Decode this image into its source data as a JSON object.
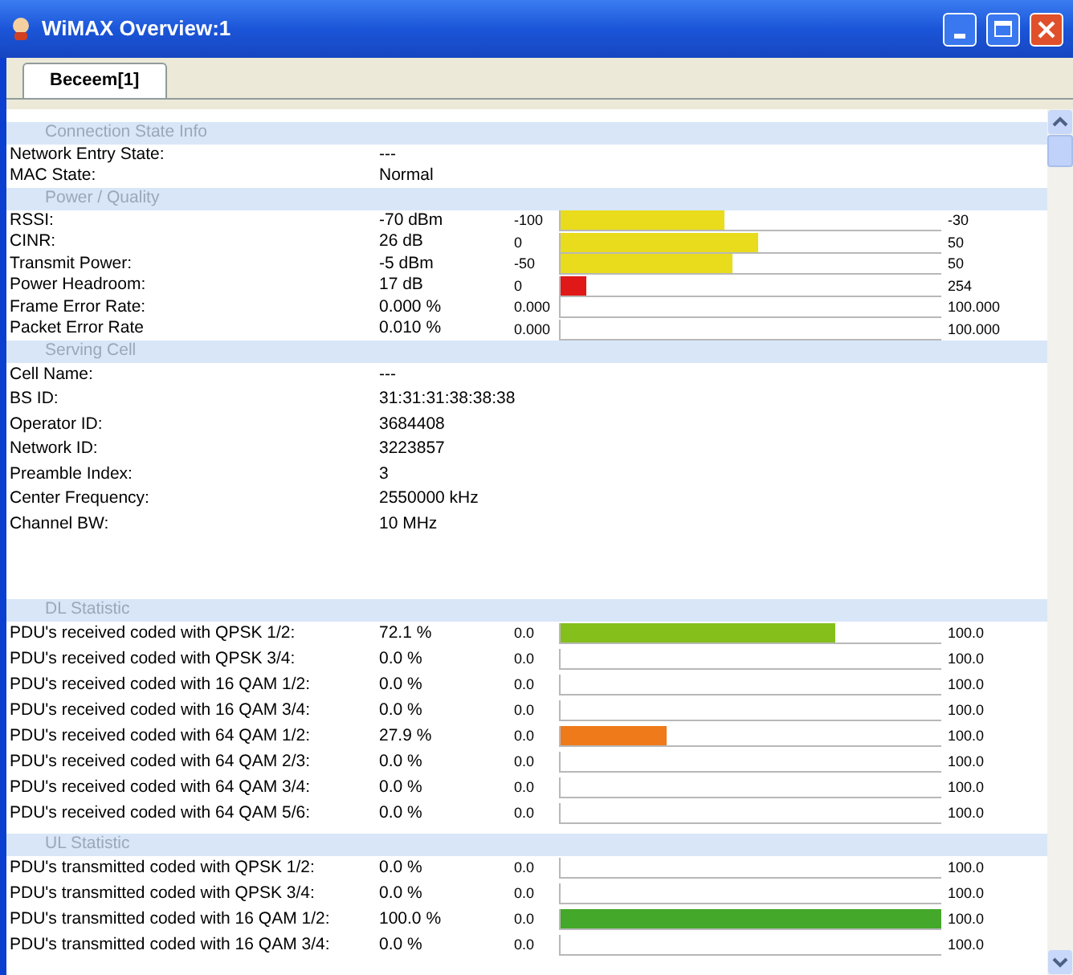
{
  "window": {
    "title": "WiMAX Overview:1"
  },
  "tabs": [
    {
      "label": "Beceem[1]",
      "selected": true
    }
  ],
  "sections": [
    {
      "title": "Connection State Info",
      "rows": [
        {
          "kind": "text",
          "label": "Network Entry State:",
          "value": "---"
        },
        {
          "kind": "text",
          "label": "MAC State:",
          "value": "Normal"
        }
      ]
    },
    {
      "title": "Power / Quality",
      "rows": [
        {
          "kind": "bar",
          "label": "RSSI:",
          "value": "-70 dBm",
          "min": "-100",
          "max": "-30",
          "level": 0.43,
          "color": "#e8dc1c"
        },
        {
          "kind": "bar",
          "label": "CINR:",
          "value": "26 dB",
          "min": "0",
          "max": "50",
          "level": 0.52,
          "color": "#e8dc1c"
        },
        {
          "kind": "bar",
          "label": "Transmit Power:",
          "value": "-5 dBm",
          "min": "-50",
          "max": "50",
          "level": 0.45,
          "color": "#e8dc1c"
        },
        {
          "kind": "bar",
          "label": "Power Headroom:",
          "value": "17 dB",
          "min": "0",
          "max": "254",
          "level": 0.067,
          "color": "#e01818"
        },
        {
          "kind": "bar",
          "label": "Frame Error Rate:",
          "value": "0.000 %",
          "min": "0.000",
          "max": "100.000"
        },
        {
          "kind": "bar",
          "label": "Packet Error Rate",
          "value": "0.010 %",
          "min": "0.000",
          "max": "100.000"
        }
      ]
    },
    {
      "title": "Serving Cell",
      "rows": [
        {
          "kind": "text",
          "label": "Cell Name:",
          "value": "---"
        },
        {
          "kind": "text",
          "label": "BS ID:",
          "value": "31:31:31:38:38:38"
        },
        {
          "kind": "text",
          "label": "Operator ID:",
          "value": "3684408"
        },
        {
          "kind": "text",
          "label": "Network ID:",
          "value": "3223857"
        },
        {
          "kind": "text",
          "label": "Preamble Index:",
          "value": "3"
        },
        {
          "kind": "text",
          "label": "Center Frequency:",
          "value": "2550000 kHz"
        },
        {
          "kind": "text",
          "label": "Channel BW:",
          "value": "10 MHz"
        }
      ]
    },
    {
      "title": "DL Statistic",
      "rows": [
        {
          "kind": "bar",
          "label": "PDU's received coded with QPSK 1/2:",
          "value": "72.1 %",
          "min": "0.0",
          "max": "100.0",
          "level": 0.721,
          "color": "#84bf1c"
        },
        {
          "kind": "bar",
          "label": "PDU's received coded with QPSK 3/4:",
          "value": "0.0 %",
          "min": "0.0",
          "max": "100.0"
        },
        {
          "kind": "bar",
          "label": "PDU's received coded with 16 QAM 1/2:",
          "value": "0.0 %",
          "min": "0.0",
          "max": "100.0"
        },
        {
          "kind": "bar",
          "label": "PDU's received coded with 16 QAM 3/4:",
          "value": "0.0 %",
          "min": "0.0",
          "max": "100.0"
        },
        {
          "kind": "bar",
          "label": "PDU's received coded with 64 QAM 1/2:",
          "value": "27.9 %",
          "min": "0.0",
          "max": "100.0",
          "level": 0.279,
          "color": "#ee7a1a"
        },
        {
          "kind": "bar",
          "label": "PDU's received coded with 64 QAM 2/3:",
          "value": "0.0 %",
          "min": "0.0",
          "max": "100.0"
        },
        {
          "kind": "bar",
          "label": "PDU's received coded with 64 QAM 3/4:",
          "value": "0.0 %",
          "min": "0.0",
          "max": "100.0"
        },
        {
          "kind": "bar",
          "label": "PDU's received coded with 64 QAM 5/6:",
          "value": "0.0 %",
          "min": "0.0",
          "max": "100.0"
        }
      ]
    },
    {
      "title": "UL Statistic",
      "rows": [
        {
          "kind": "bar",
          "label": "PDU's transmitted coded with QPSK 1/2:",
          "value": "0.0 %",
          "min": "0.0",
          "max": "100.0"
        },
        {
          "kind": "bar",
          "label": "PDU's transmitted coded with QPSK 3/4:",
          "value": "0.0 %",
          "min": "0.0",
          "max": "100.0"
        },
        {
          "kind": "bar",
          "label": "PDU's transmitted coded with 16 QAM 1/2:",
          "value": "100.0 %",
          "min": "0.0",
          "max": "100.0",
          "level": 1,
          "color": "#44a82a"
        },
        {
          "kind": "bar",
          "label": "PDU's transmitted coded with 16 QAM 3/4:",
          "value": "0.0 %",
          "min": "0.0",
          "max": "100.0"
        }
      ]
    }
  ]
}
